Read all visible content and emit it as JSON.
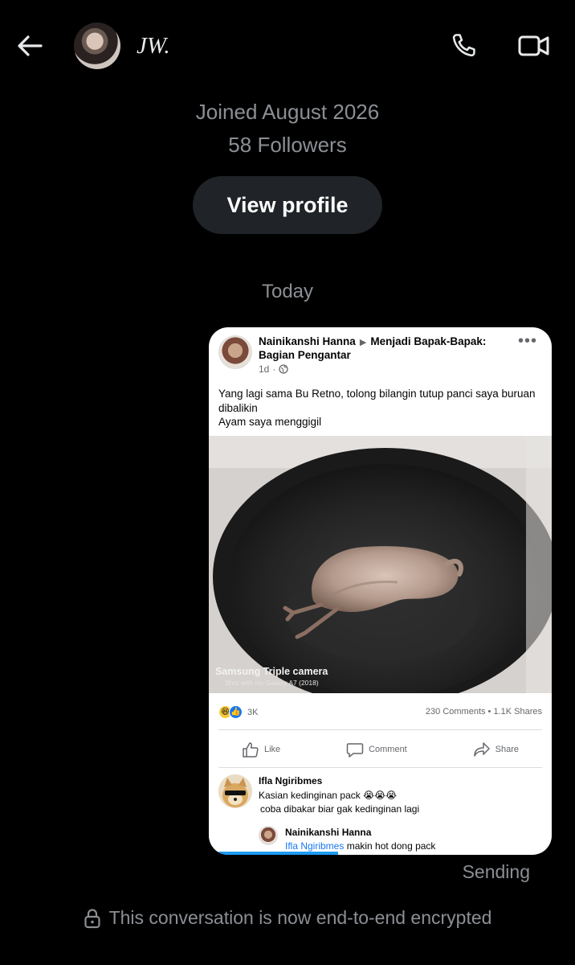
{
  "header": {
    "handle": "JW.",
    "back_icon": "arrow-left-icon",
    "call_icon": "phone-icon",
    "video_icon": "video-camera-icon"
  },
  "profile": {
    "joined": "Joined August 2026",
    "followers": "58 Followers",
    "view_profile_label": "View profile"
  },
  "day_separator": "Today",
  "shared_post": {
    "author": "Nainikanshi Hanna",
    "group": "Menjadi Bapak-Bapak: Bagian Pengantar",
    "time": "1d",
    "text": "Yang lagi sama Bu Retno, tolong bilangin tutup  panci saya buruan dibalikin\nAyam saya menggigil",
    "photo_caption": "Samsung Triple camera",
    "photo_subcaption": "Shot with my Galaxy A7 (2018)",
    "reaction_count": "3K",
    "engagement": "230 Comments • 1.1K Shares",
    "actions": {
      "like": "Like",
      "comment": "Comment",
      "share": "Share"
    },
    "comment": {
      "author": "Ifla Ngiribmes",
      "line1": "Kasian kedinginan pack 😭😭😭",
      "line2": "coba dibakar biar gak kedinginan lagi"
    },
    "reply": {
      "author": "Nainikanshi Hanna",
      "mention": "Ifla Ngiribmes",
      "text": " makin hot dong pack"
    },
    "upload_progress": 0.37
  },
  "status": "Sending",
  "encryption_notice": "This conversation is now end-to-end encrypted",
  "colors": {
    "background": "#000000",
    "muted_text": "#8b8f94",
    "button_bg": "#202327",
    "facebook_blue": "#1877f2",
    "progress_blue": "#1d9bf0"
  }
}
